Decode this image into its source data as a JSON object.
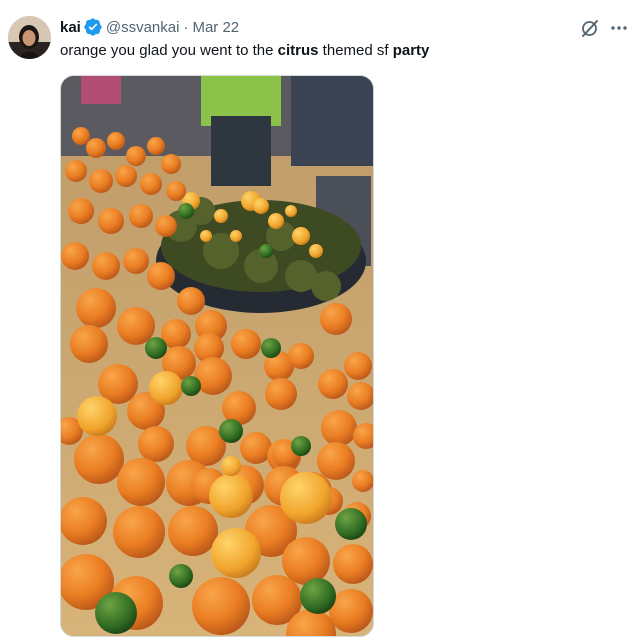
{
  "tweet": {
    "author_name": "kai",
    "handle": "@ssvankai",
    "separator": "·",
    "date": "Mar 22",
    "text_parts": {
      "t1": "orange you glad you went to the ",
      "t2": "citrus",
      "t3": " themed sf ",
      "t4": "party"
    },
    "verified": true
  },
  "icons": {
    "verified": "verified-badge-icon",
    "grok": "grok-icon",
    "more": "more-horizontal-icon"
  },
  "colors": {
    "verified_blue": "#1d9bf0",
    "secondary_text": "#536471",
    "primary_text": "#0f1419"
  }
}
